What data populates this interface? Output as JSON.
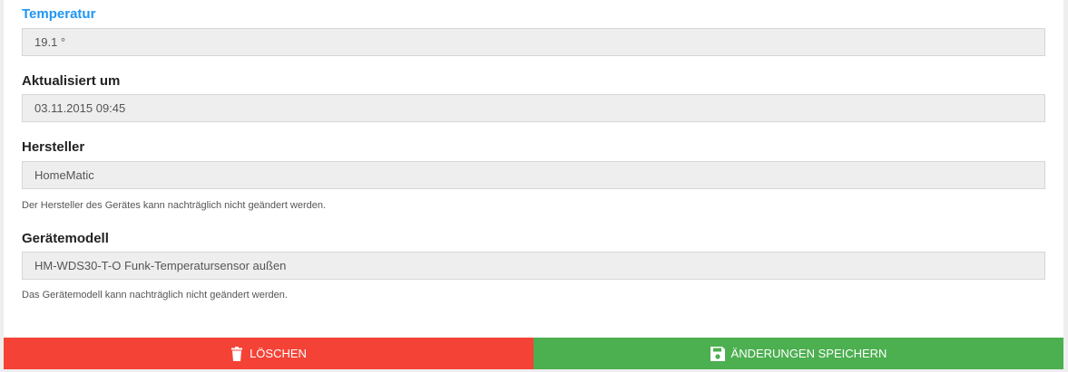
{
  "fields": {
    "temperature": {
      "label": "Temperatur",
      "value": "19.1 °"
    },
    "updated": {
      "label": "Aktualisiert um",
      "value": "03.11.2015 09:45"
    },
    "manufacturer": {
      "label": "Hersteller",
      "value": "HomeMatic",
      "help": "Der Hersteller des Gerätes kann nachträglich nicht geändert werden."
    },
    "model": {
      "label": "Gerätemodell",
      "value": "HM-WDS30-T-O Funk-Temperatursensor außen",
      "help": "Das Gerätemodell kann nachträglich nicht geändert werden."
    }
  },
  "actions": {
    "delete_label": "LÖSCHEN",
    "save_label": "ÄNDERUNGEN SPEICHERN"
  },
  "colors": {
    "active_label": "#2196f3",
    "delete": "#f44336",
    "save": "#4caf50"
  },
  "icons": {
    "delete": "trash-icon",
    "save": "floppy-disk-icon"
  }
}
